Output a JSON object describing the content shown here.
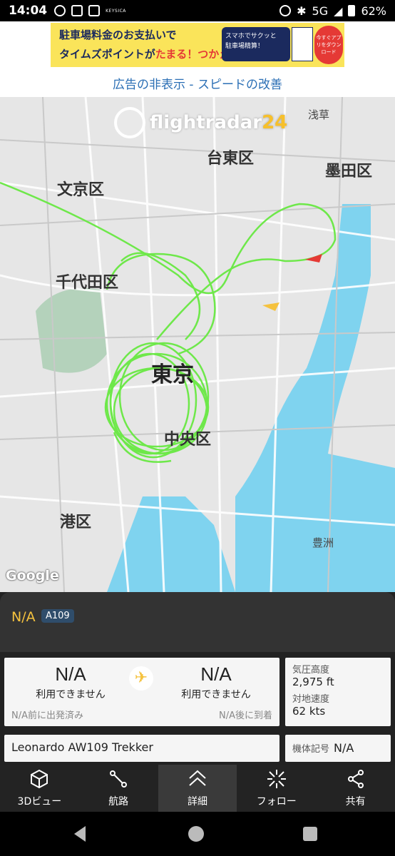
{
  "status_bar": {
    "time": "14:04",
    "network": "5G",
    "battery": "62%",
    "small_text": "KEYSICA"
  },
  "ad": {
    "line1": "駐車場料金のお支払いで",
    "line2_a": "タイムズポイントが",
    "line2_b": "たまる！つかえる！",
    "box_line1": "スマホでサクッと",
    "box_line2": "駐車場精算！",
    "circle_text": "今すぐアプリをダウンロード"
  },
  "remove_ads": "広告の非表示 - スピードの改善",
  "map": {
    "logo_main": "flightradar",
    "logo_num": "24",
    "labels": {
      "asakusa": "浅草",
      "taito": "台東区",
      "sumida": "墨田区",
      "bunkyo": "文京区",
      "chiyoda": "千代田区",
      "tokyo": "東京",
      "chuo": "中央区",
      "minato": "港区",
      "toyosu": "豊洲"
    },
    "google": "Google"
  },
  "flight": {
    "callsign": "N/A",
    "aircraft_type": "A109",
    "origin_code": "N/A",
    "origin_city": "利用できません",
    "dest_code": "N/A",
    "dest_city": "利用できません",
    "departed": "N/A前に出発済み",
    "arrival": "N/A後に到着",
    "baro_alt_label": "気圧高度",
    "baro_alt_value": "2,975 ft",
    "ground_speed_label": "対地速度",
    "ground_speed_value": "62 kts",
    "model": "Leonardo AW109 Trekker",
    "reg_label": "機体記号",
    "reg_value": "N/A"
  },
  "bottom_nav": [
    {
      "label": "3Dビュー",
      "icon": "cube-icon"
    },
    {
      "label": "航路",
      "icon": "route-icon"
    },
    {
      "label": "詳細",
      "icon": "chevron-up-icon"
    },
    {
      "label": "フォロー",
      "icon": "follow-icon"
    },
    {
      "label": "共有",
      "icon": "share-icon"
    }
  ],
  "colors": {
    "track": "#6ee84a",
    "callsign": "#f5c23e",
    "link": "#2b6fb5",
    "water": "#7fd3ef",
    "map_bg": "#e6e6e6"
  }
}
